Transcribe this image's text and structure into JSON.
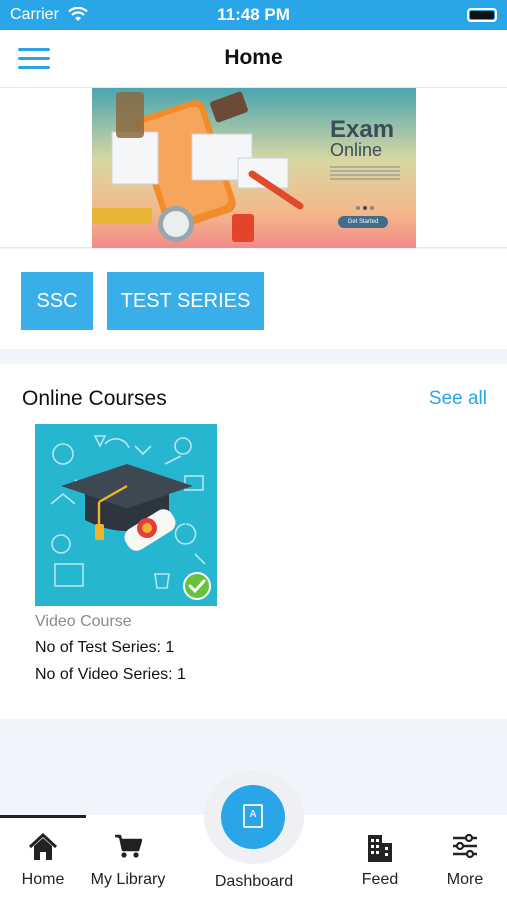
{
  "status_bar": {
    "carrier": "Carrier",
    "time": "11:48 PM"
  },
  "nav": {
    "title": "Home"
  },
  "banner": {
    "title": "Exam",
    "subtitle": "Online",
    "cta": "Get Started"
  },
  "categories": [
    {
      "label": "SSC"
    },
    {
      "label": "TEST SERIES"
    }
  ],
  "courses_section": {
    "title": "Online Courses",
    "see_all": "See all",
    "courses": [
      {
        "type": "Video Course",
        "test_series": "No of Test Series: 1",
        "video_series": "No of Video Series: 1"
      }
    ]
  },
  "tabs": {
    "home": "Home",
    "library": "My Library",
    "dashboard": "Dashboard",
    "feed": "Feed",
    "more": "More"
  },
  "colors": {
    "accent": "#2aa6e8",
    "chip": "#3aaee8",
    "background": "#f1f4fa",
    "thumb": "#27b6cf"
  }
}
